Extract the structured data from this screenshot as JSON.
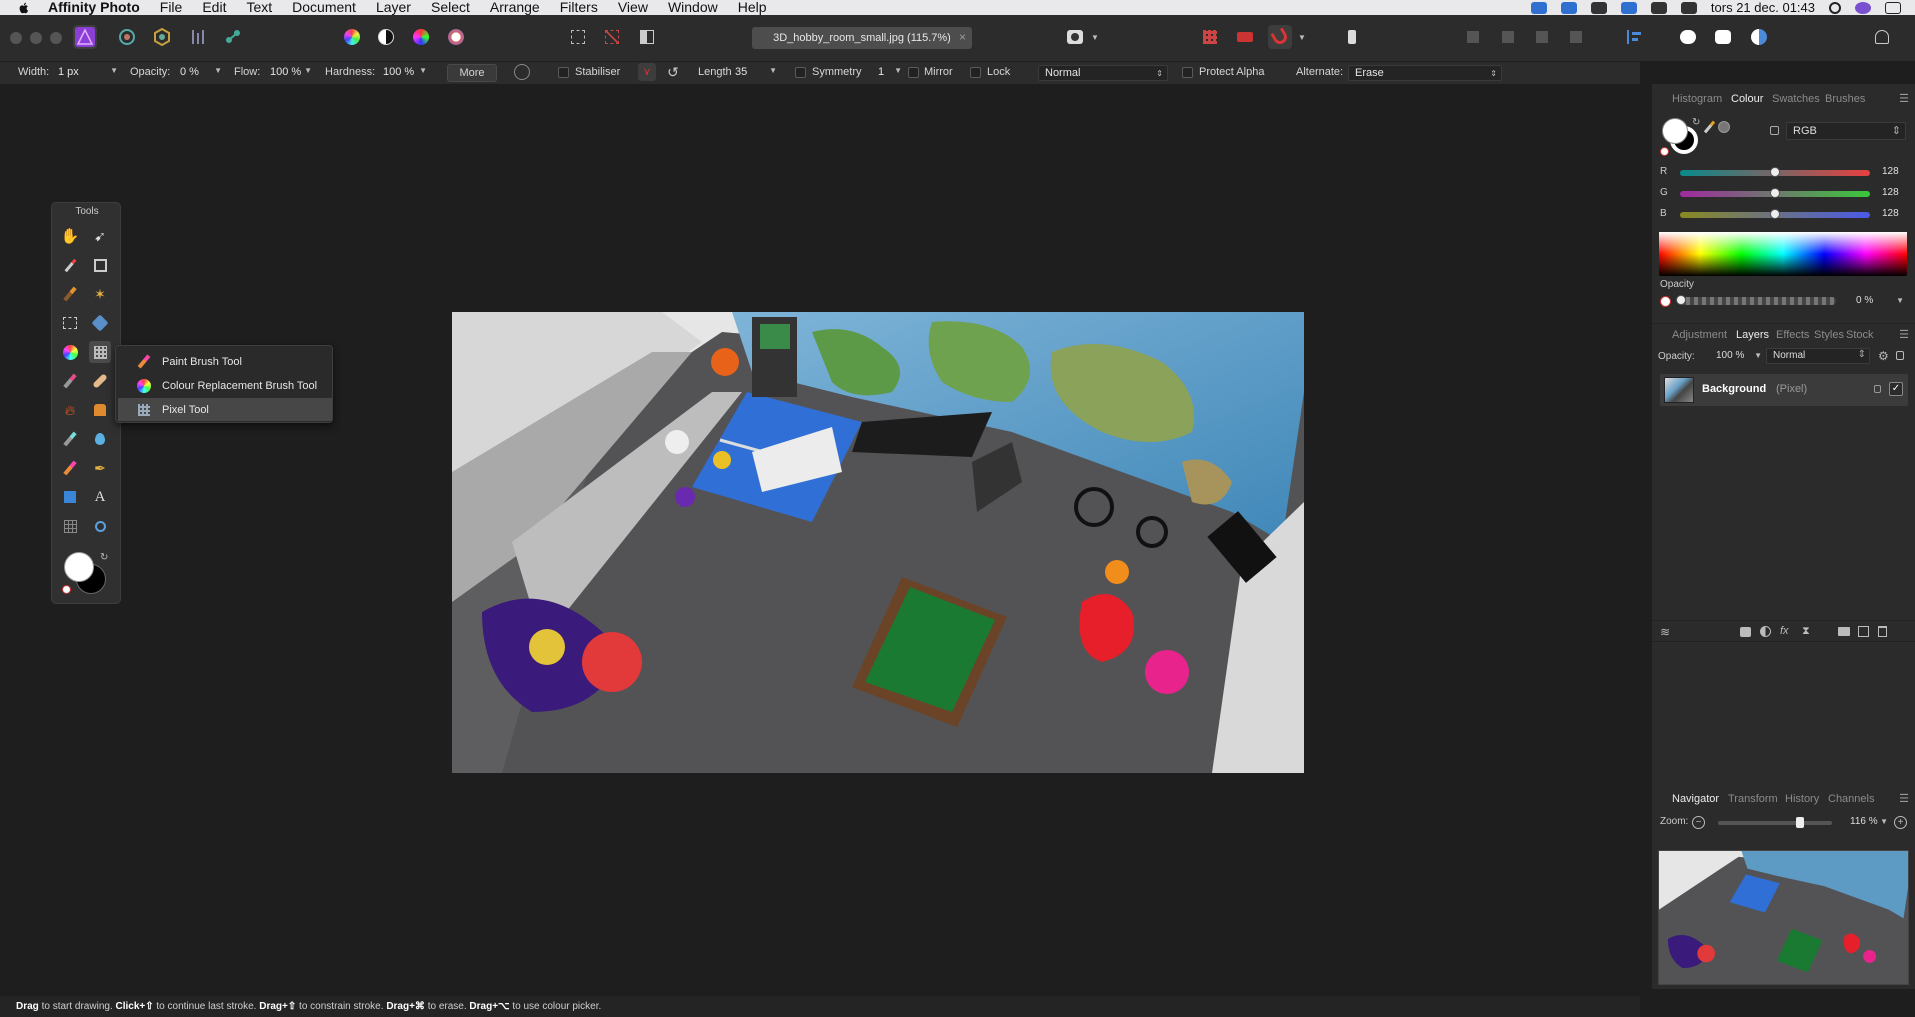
{
  "menubar": {
    "app_name": "Affinity Photo",
    "items": [
      "File",
      "Edit",
      "Text",
      "Document",
      "Layer",
      "Select",
      "Arrange",
      "Filters",
      "View",
      "Window",
      "Help"
    ],
    "clock": "tors 21 dec.  01:43"
  },
  "document_tab": {
    "title": "3D_hobby_room_small.jpg (115.7%)",
    "close_glyph": "×"
  },
  "context_toolbar": {
    "width_label": "Width:",
    "width_value": "1 px",
    "opacity_label": "Opacity:",
    "opacity_value": "0 %",
    "flow_label": "Flow:",
    "flow_value": "100 %",
    "hardness_label": "Hardness:",
    "hardness_value": "100 %",
    "more_label": "More",
    "stabiliser_label": "Stabiliser",
    "length_label": "Length",
    "length_value": "35",
    "symmetry_label": "Symmetry",
    "symmetry_value": "1",
    "mirror_label": "Mirror",
    "lock_label": "Lock",
    "blend_mode": "Normal",
    "protect_alpha_label": "Protect Alpha",
    "alternate_label": "Alternate:",
    "alternate_value": "Erase"
  },
  "tools_panel": {
    "title": "Tools"
  },
  "brush_flyout": {
    "items": [
      {
        "label": "Paint Brush Tool",
        "icon": "paint-brush-icon"
      },
      {
        "label": "Colour Replacement Brush Tool",
        "icon": "colour-replacement-brush-icon"
      },
      {
        "label": "Pixel Tool",
        "icon": "pixel-tool-icon",
        "selected": true
      }
    ]
  },
  "colour_panel": {
    "tabs": [
      "Histogram",
      "Colour",
      "Swatches",
      "Brushes"
    ],
    "active_tab": "Colour",
    "model": "RGB",
    "channels": [
      {
        "label": "R",
        "value": "128",
        "level": 0.5
      },
      {
        "label": "G",
        "value": "128",
        "level": 0.5
      },
      {
        "label": "B",
        "value": "128",
        "level": 0.5
      }
    ],
    "opacity_label": "Opacity",
    "opacity_value": "0 %"
  },
  "layers_panel": {
    "tabs": [
      "Adjustment",
      "Layers",
      "Effects",
      "Styles",
      "Stock"
    ],
    "active_tab": "Layers",
    "opacity_label": "Opacity:",
    "opacity_value": "100 %",
    "blend_mode": "Normal",
    "layers": [
      {
        "name": "Background",
        "type": "(Pixel)",
        "visible": true
      }
    ]
  },
  "navigator_panel": {
    "tabs": [
      "Navigator",
      "Transform",
      "History",
      "Channels"
    ],
    "active_tab": "Navigator",
    "zoom_label": "Zoom:",
    "zoom_value": "116 %",
    "zoom_level": 0.72
  },
  "status_bar": {
    "segments": [
      {
        "key": "Drag",
        "text": " to start drawing. "
      },
      {
        "key": "Click+⇧",
        "text": " to continue last stroke. "
      },
      {
        "key": "Drag+⇧",
        "text": " to constrain stroke. "
      },
      {
        "key": "Drag+⌘",
        "text": " to erase. "
      },
      {
        "key": "Drag+⌥",
        "text": " to use colour picker."
      }
    ]
  },
  "colors": {
    "accent": "#4a8ad8",
    "app_icon": "#8b3fd6",
    "panel_bg": "#2b2b2b",
    "workspace_bg": "#1e1e1e"
  }
}
